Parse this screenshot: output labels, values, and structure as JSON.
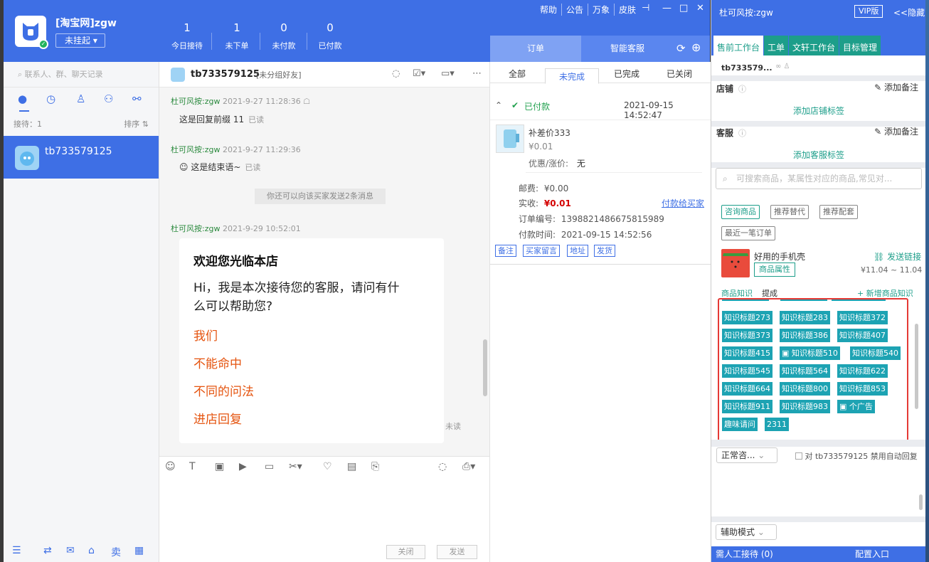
{
  "header": {
    "shop_name": "[淘宝网]zgw",
    "status": "未挂起",
    "status_caret": "▾",
    "stats": [
      {
        "num": "1",
        "label": "今日接待"
      },
      {
        "num": "1",
        "label": "未下单"
      },
      {
        "num": "0",
        "label": "未付款"
      },
      {
        "num": "0",
        "label": "已付款"
      }
    ],
    "menu": [
      "帮助",
      "公告",
      "万象",
      "皮肤"
    ],
    "tabs": [
      "订单",
      "智能客服"
    ]
  },
  "left": {
    "search_placeholder": "联系人、群、聊天记录",
    "reception": "接待：1",
    "sort": "排序 ⇅",
    "contact_name": "tb733579125"
  },
  "chat": {
    "contact": "tb733579125",
    "tag": "[未分组好友]",
    "messages": [
      {
        "sender": "杜可风按:zgw",
        "time": "2021-9-27 11:28:36",
        "text": "这是回复前缀 11",
        "state": "已读"
      },
      {
        "sender": "杜可风按:zgw",
        "time": "2021-9-27 11:29:36",
        "text": "这是结束语~",
        "state": "已读"
      },
      {
        "sender": "杜可风按:zgw",
        "time": "2021-9-29 10:52:01"
      }
    ],
    "system_note": "你还可以向该买家发送2条消息",
    "card": {
      "title": "欢迎您光临本店",
      "body": "Hi，我是本次接待您的客服，请问有什么可以帮助您?",
      "options": [
        "我们",
        "不能命中",
        "不同的问法",
        "进店回复"
      ]
    },
    "unread": "未读",
    "close_btn": "关闭",
    "send_btn": "发送"
  },
  "order": {
    "tabs": [
      "全部",
      "未完成",
      "已完成",
      "已关闭"
    ],
    "active_tab": "未完成",
    "status": "已付款",
    "status_time": "2021-09-15 14:52:47",
    "item_name": "补差价333",
    "item_price": "¥0.01",
    "discount_label": "优惠/涨价:",
    "discount_value": "无",
    "postage_label": "邮费:",
    "postage_value": "¥0.00",
    "paid_label": "实收:",
    "paid_value": "¥0.01",
    "pay_link": "付款给买家",
    "order_no_label": "订单编号:",
    "order_no": "1398821486675815989",
    "pay_time_label": "付款时间:",
    "pay_time": "2021-09-15 14:52:56",
    "tags": [
      "备注",
      "买家留言",
      "地址",
      "发货"
    ]
  },
  "right": {
    "title": "杜可风按:zgw",
    "vip": "VIP版",
    "hide": "<<隐藏",
    "tabs": [
      "售前工作台",
      "工单",
      "文轩工作台",
      "目标管理"
    ],
    "customer": "tb733579...",
    "shop_label": "店铺",
    "add_note": "添加备注",
    "add_shop_tag": "添加店铺标签",
    "service_label": "客服",
    "add_service_tag": "添加客服标签",
    "search_placeholder": "可搜索商品，某属性对应的商品,常见对...",
    "chips": [
      "咨询商品",
      "推荐替代",
      "推荐配套",
      "最近一笔订单"
    ],
    "product_name": "好用的手机壳",
    "product_attr": "商品属性",
    "send_link": "发送链接",
    "price_range": "¥11.04 ~ 11.04",
    "subtabs": [
      "商品知识",
      "提成"
    ],
    "new_knowledge": "+ 新增商品知识",
    "knowledge_tags": [
      "知识标题273",
      "知识标题283",
      "知识标题372",
      "知识标题373",
      "知识标题386",
      "知识标题407",
      "知识标题415",
      "知识标题510",
      "知识标题540",
      "知识标题545",
      "知识标题564",
      "知识标题622",
      "知识标题664",
      "知识标题800",
      "知识标题853",
      "知识标题911",
      "知识标题983",
      "个广告",
      "趣味请问",
      "2311"
    ],
    "consult_mode": "正常咨...",
    "auto_reply": "对 tb733579125 禁用自动回复",
    "assist_mode": "辅助模式",
    "need_human": "需人工接待 (0)",
    "config": "配置入口"
  }
}
